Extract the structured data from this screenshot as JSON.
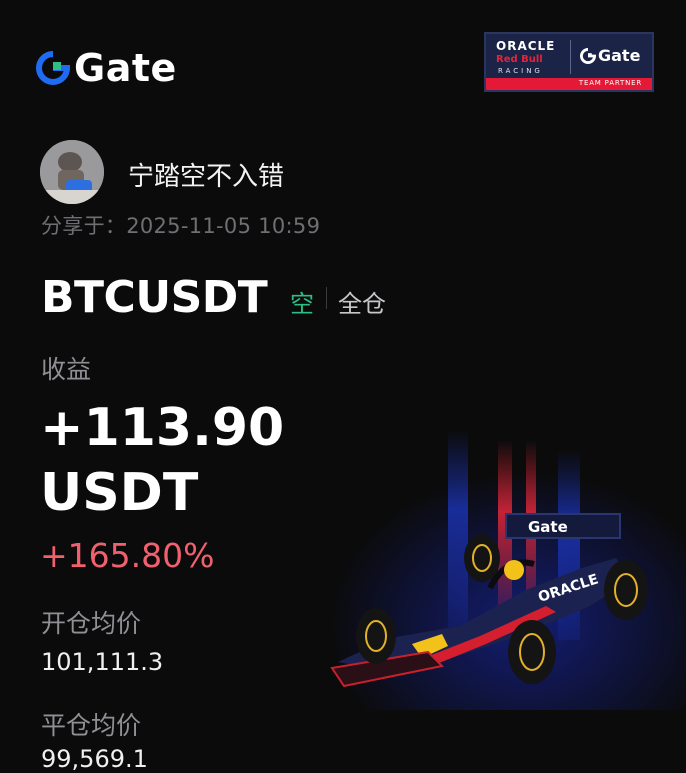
{
  "brand": {
    "name": "Gate"
  },
  "partner": {
    "oracle": "ORACLE",
    "redbull": "Red Bull",
    "racing": "RACING",
    "gate": "Gate",
    "team": "TEAM PARTNER"
  },
  "user": {
    "name": "宁踏空不入错",
    "shared": "分享于：2025-11-05 10:59"
  },
  "position": {
    "pair": "BTCUSDT",
    "side": "空",
    "margin": "全仓"
  },
  "pnl": {
    "label": "收益",
    "amount": "+113.90",
    "unit": "USDT",
    "percent": "+165.80%"
  },
  "entry": {
    "label": "开仓均价",
    "value": "101,111.3"
  },
  "close": {
    "label": "平仓均价",
    "value": "99,569.1"
  },
  "car_sponsors": {
    "nose": "Gate",
    "sidepod": "ORACLE"
  },
  "colors": {
    "background": "#0b0b0c",
    "profit": "#f0616d",
    "short": "#2ebd85",
    "brand_blue": "#1f6cf2",
    "brand_green": "#2ebd85"
  }
}
